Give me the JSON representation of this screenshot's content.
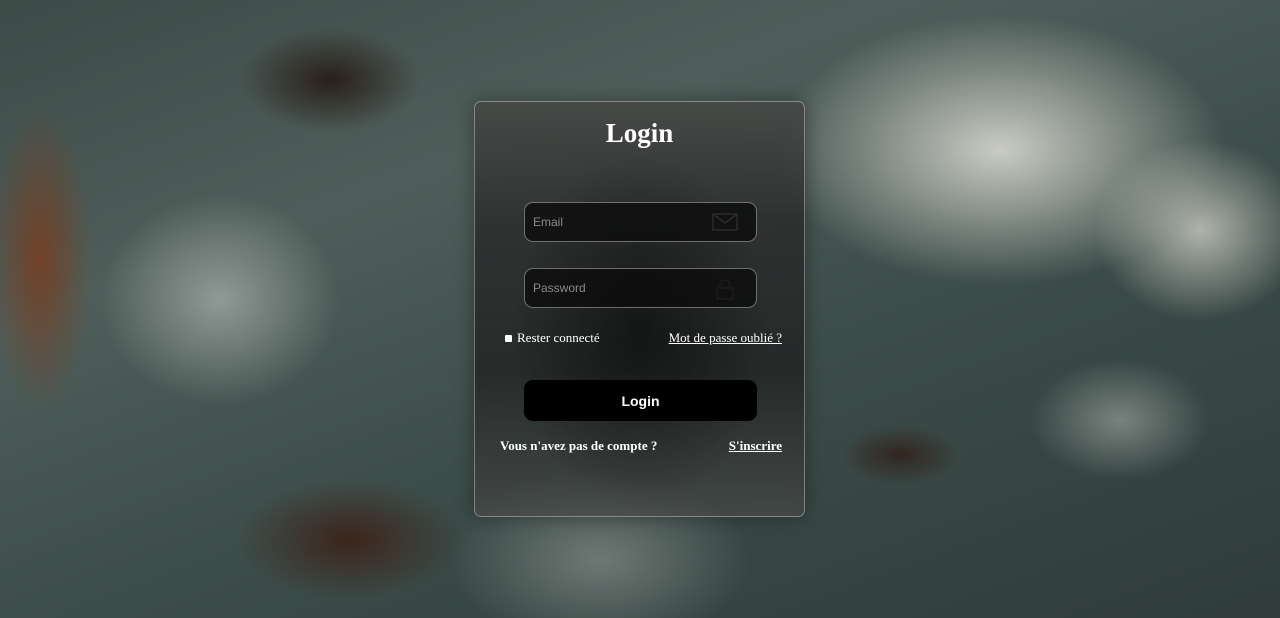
{
  "login_card": {
    "title": "Login",
    "email": {
      "placeholder": "Email",
      "value": "",
      "icon": "envelope-icon"
    },
    "password": {
      "placeholder": "Password",
      "value": "",
      "icon": "lock-icon"
    },
    "remember_label": "Rester connecté",
    "forgot_link": "Mot de passe oublié ?",
    "submit_label": "Login",
    "register_prompt": "Vous n'avez pas de compte ?",
    "register_link": "S'inscrire"
  },
  "colors": {
    "text": "#ffffff",
    "button_bg": "#000000",
    "input_bg": "#0c0c0c"
  }
}
